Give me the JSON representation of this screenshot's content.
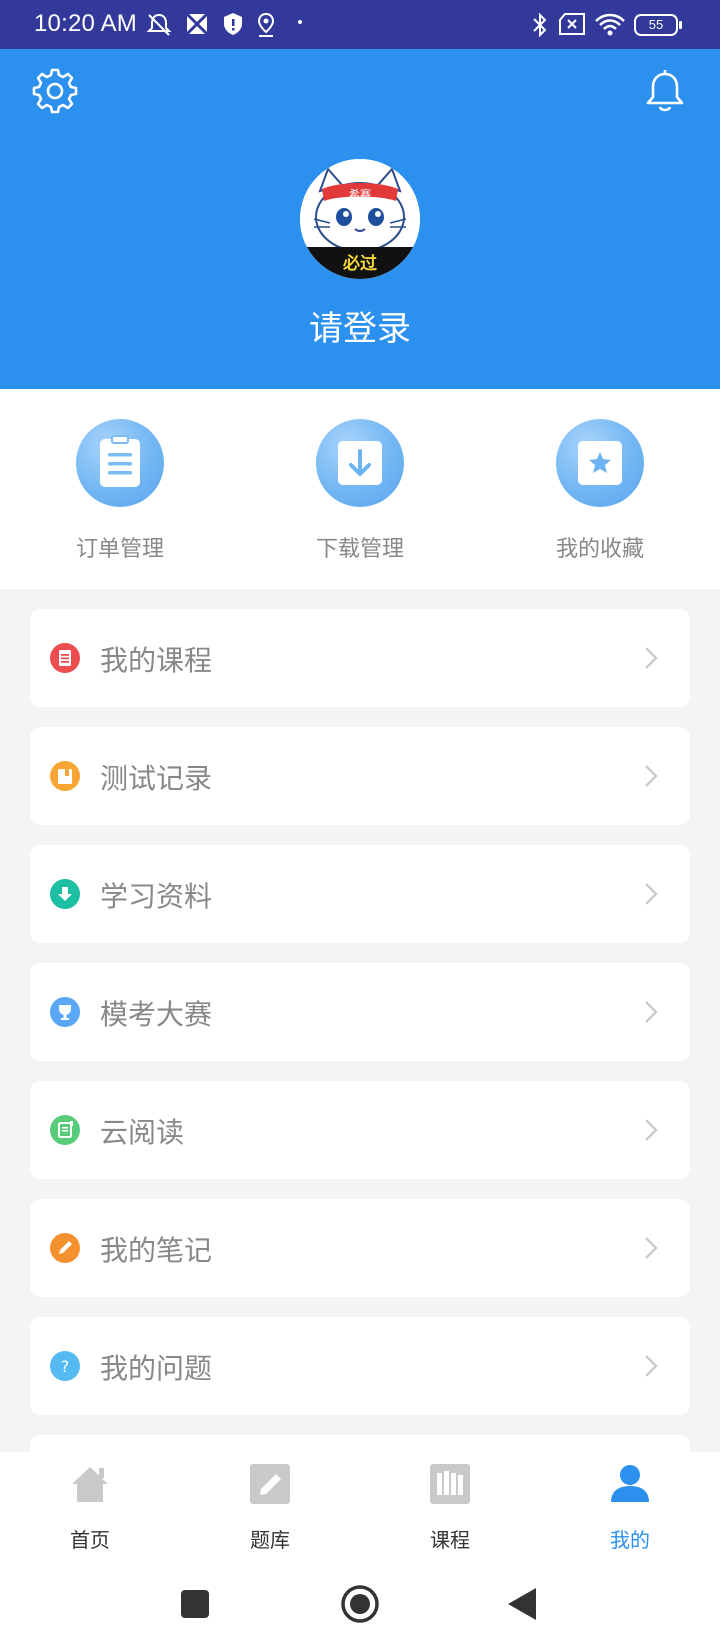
{
  "status": {
    "time": "10:20 AM",
    "battery": "55",
    "icons": [
      "bell-off-icon",
      "photos-icon",
      "shield-icon",
      "location-icon",
      "bluetooth-icon",
      "sim-x-icon",
      "wifi-icon",
      "battery-icon"
    ]
  },
  "header": {
    "settings_icon": "gear-icon",
    "notification_icon": "bell-icon",
    "avatar_badge_top": "希赛",
    "avatar_badge_bottom": "必过",
    "login_text": "请登录",
    "background": "#2c91ee"
  },
  "quick_actions": [
    {
      "label": "订单管理",
      "icon": "clipboard-icon"
    },
    {
      "label": "下载管理",
      "icon": "download-icon"
    },
    {
      "label": "我的收藏",
      "icon": "star-icon"
    }
  ],
  "menu": [
    {
      "label": "我的课程",
      "icon": "course-icon",
      "color": "#ec4d4f"
    },
    {
      "label": "测试记录",
      "icon": "test-record-icon",
      "color": "#f7a636"
    },
    {
      "label": "学习资料",
      "icon": "material-download-icon",
      "color": "#1dbfa3"
    },
    {
      "label": "模考大赛",
      "icon": "trophy-icon",
      "color": "#5aa7f5"
    },
    {
      "label": "云阅读",
      "icon": "reading-icon",
      "color": "#58cc79"
    },
    {
      "label": "我的笔记",
      "icon": "pencil-icon",
      "color": "#f5902f"
    },
    {
      "label": "我的问题",
      "icon": "question-icon",
      "color": "#55b9f2"
    }
  ],
  "bottom_nav": [
    {
      "label": "首页",
      "icon": "home-icon",
      "active": false
    },
    {
      "label": "题库",
      "icon": "edit-icon",
      "active": false
    },
    {
      "label": "课程",
      "icon": "books-icon",
      "active": false
    },
    {
      "label": "我的",
      "icon": "user-icon",
      "active": true
    }
  ],
  "accent_color": "#2c91ee"
}
